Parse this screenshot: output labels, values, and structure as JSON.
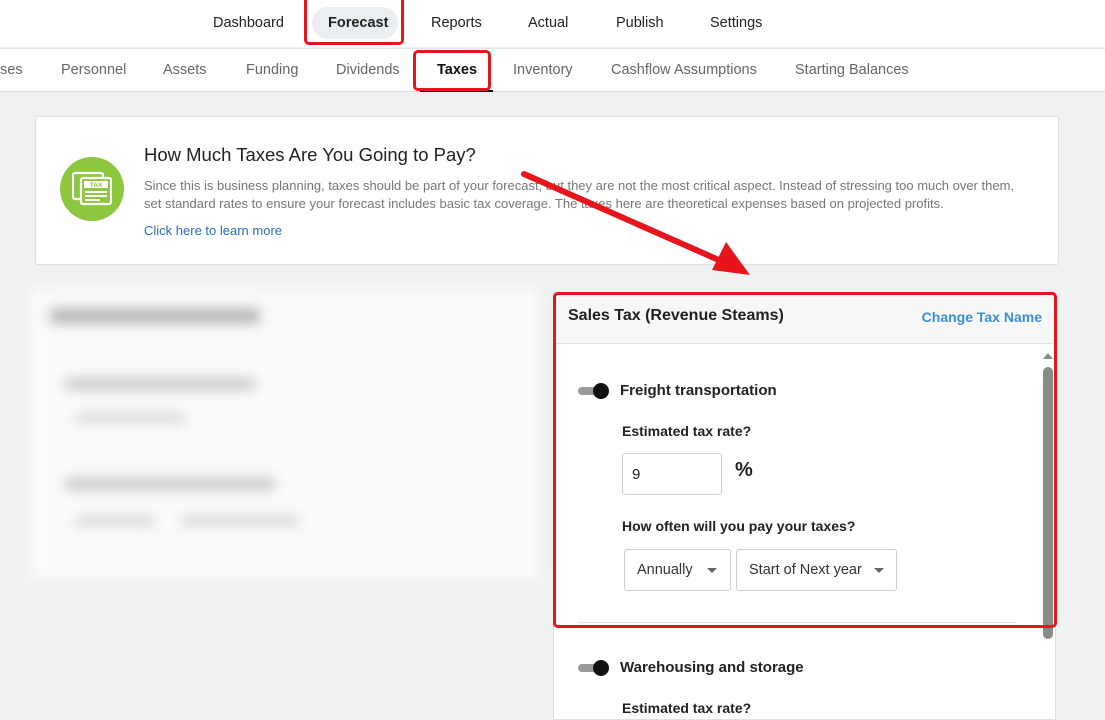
{
  "top_nav": {
    "items": [
      "Dashboard",
      "Forecast",
      "Reports",
      "Actual",
      "Publish",
      "Settings"
    ],
    "active": "Forecast"
  },
  "sub_nav": {
    "items": [
      "ses",
      "Personnel",
      "Assets",
      "Funding",
      "Dividends",
      "Taxes",
      "Inventory",
      "Cashflow Assumptions",
      "Starting Balances"
    ],
    "active": "Taxes"
  },
  "info_card": {
    "icon": "tax-document-icon",
    "icon_label": "TAX",
    "title": "How Much Taxes Are You Going to Pay?",
    "text": "Since this is business planning, taxes should be part of your forecast, but they are not the most critical aspect. Instead of stressing too much over them, set standard rates to ensure your forecast includes basic tax coverage. The taxes here are theoretical expenses based on projected profits.",
    "link": "Click here to learn more"
  },
  "sales_tax": {
    "title": "Sales Tax (Revenue Steams)",
    "change_name": "Change Tax Name",
    "streams": [
      {
        "name": "Freight transportation",
        "enabled": true,
        "rate_label": "Estimated tax rate?",
        "rate_value": "9",
        "unit": "%",
        "frequency_label": "How often will you pay your taxes?",
        "frequency": "Annually",
        "timing": "Start of Next year"
      },
      {
        "name": "Warehousing and storage",
        "enabled": true,
        "rate_label": "Estimated tax rate?"
      }
    ]
  },
  "colors": {
    "highlight": "#e8141c",
    "accent_link": "#3b8fd8",
    "tax_badge": "#8dc63f"
  }
}
